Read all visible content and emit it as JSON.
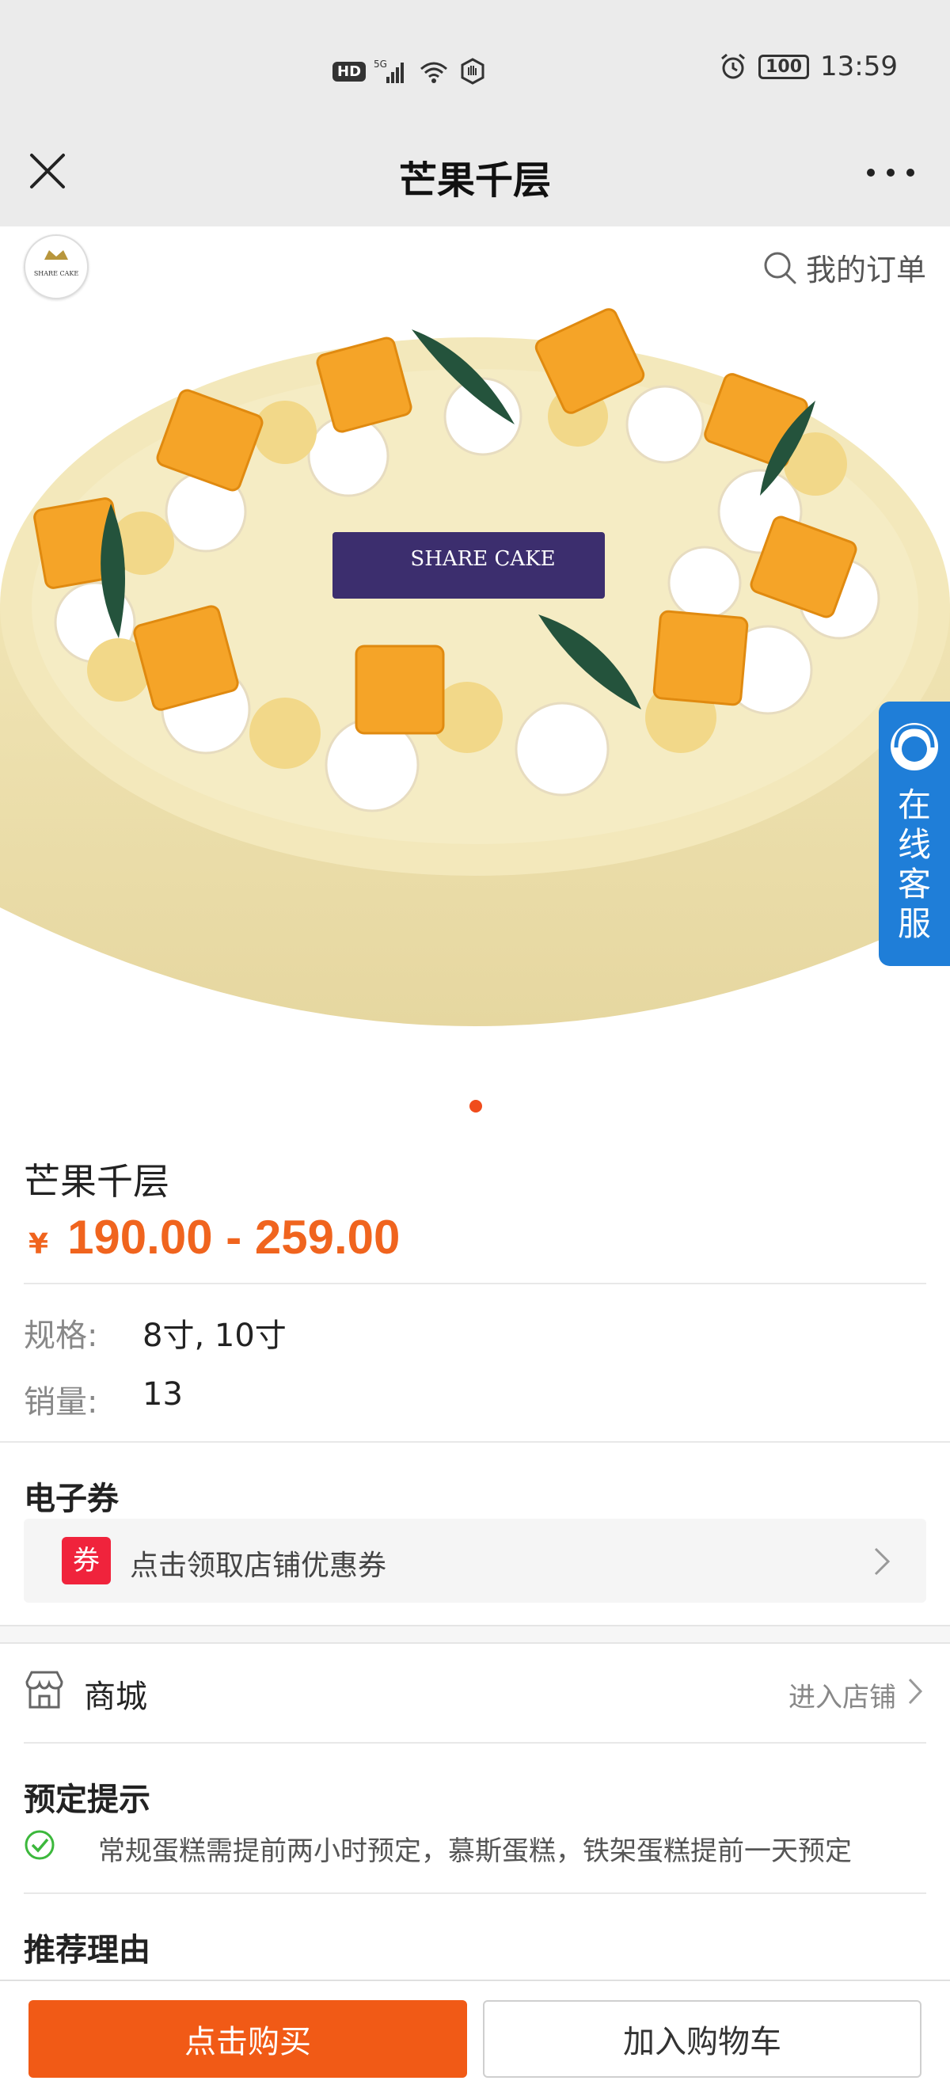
{
  "status_bar": {
    "network_badge": "HD",
    "signal_1": "5G",
    "signal_2": "6",
    "battery": "100",
    "time": "13:59"
  },
  "nav": {
    "title": "芒果千层",
    "close_icon": "close-icon",
    "more_icon": "more-icon"
  },
  "hero": {
    "logo_text": "SHARE CAKE",
    "cake_plaque_text": "SHARE CAKE",
    "my_orders_label": "我的订单",
    "customer_service_label": "在线客服",
    "carousel_active_index": 1,
    "carousel_count": 1
  },
  "product": {
    "name": "芒果千层",
    "currency": "¥",
    "price_range": "190.00 - 259.00",
    "spec_label": "规格:",
    "spec_value": "8寸, 10寸",
    "sales_label": "销量:",
    "sales_value": "13"
  },
  "coupon": {
    "section_title": "电子券",
    "badge": "券",
    "text": "点击领取店铺优惠券"
  },
  "shop": {
    "label": "商城",
    "enter_label": "进入店铺"
  },
  "notice": {
    "title": "预定提示",
    "text": "常规蛋糕需提前两小时预定，慕斯蛋糕，铁架蛋糕提前一天预定"
  },
  "recommend": {
    "title": "推荐理由"
  },
  "actions": {
    "buy_label": "点击购买",
    "cart_label": "加入购物车"
  },
  "colors": {
    "accent": "#f15a16",
    "price": "#f0641e",
    "coupon_badge": "#f0233c",
    "service_tab": "#1f7ed8"
  }
}
